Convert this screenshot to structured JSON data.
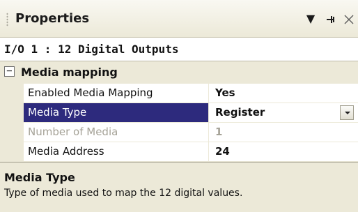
{
  "panel": {
    "title": "Properties",
    "icons": {
      "dropdown": "dropdown-arrow-icon",
      "pin": "pin-icon",
      "close": "close-icon"
    },
    "glyphs": {
      "dropdown": "▼",
      "pin": "ꟼ",
      "close": "✕"
    }
  },
  "object_selector": {
    "value": "I/O 1 : 12 Digital Outputs"
  },
  "category": {
    "expander": "⊟",
    "label": "Media mapping"
  },
  "properties": [
    {
      "name": "Enabled Media Mapping",
      "value": "Yes",
      "state": "normal"
    },
    {
      "name": "Media Type",
      "value": "Register",
      "state": "selected"
    },
    {
      "name": "Number of Media",
      "value": "1",
      "state": "disabled"
    },
    {
      "name": "Media Address",
      "value": "24",
      "state": "normal"
    }
  ],
  "description": {
    "title": "Media Type",
    "text": "Type of media used to map the 12 digital values."
  },
  "colors": {
    "selection": "#2d2a7d",
    "background": "#ece9d8",
    "disabled_text": "#a5a297"
  }
}
